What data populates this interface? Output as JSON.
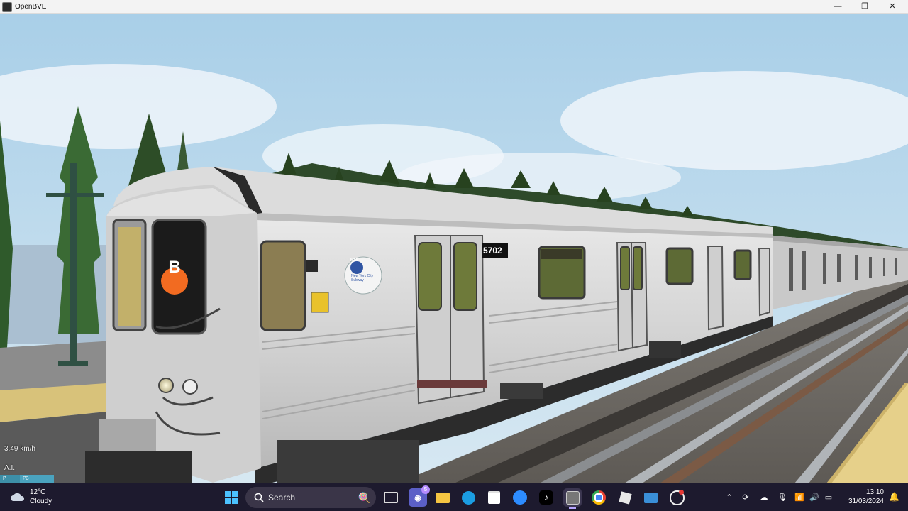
{
  "window": {
    "title": "OpenBVE",
    "minimize": "—",
    "maximize": "❐",
    "close": "✕"
  },
  "scene": {
    "route_letter": "B",
    "car_number": "5702",
    "logo_text": "New York City Subway",
    "logo_mark": "MTA"
  },
  "hud": {
    "speed": "3.49 km/h",
    "mode": "A.I.",
    "bar_left": "P",
    "bar_right": "P3"
  },
  "taskbar": {
    "weather_temp": "12°C",
    "weather_desc": "Cloudy",
    "search_placeholder": "Search",
    "chat_badge": "5",
    "time": "13:10",
    "date": "31/03/2024"
  },
  "colors": {
    "route_bullet": "#f26b21",
    "taskbar_bg": "#1d1a2e",
    "sky": "#b8d6ea"
  }
}
